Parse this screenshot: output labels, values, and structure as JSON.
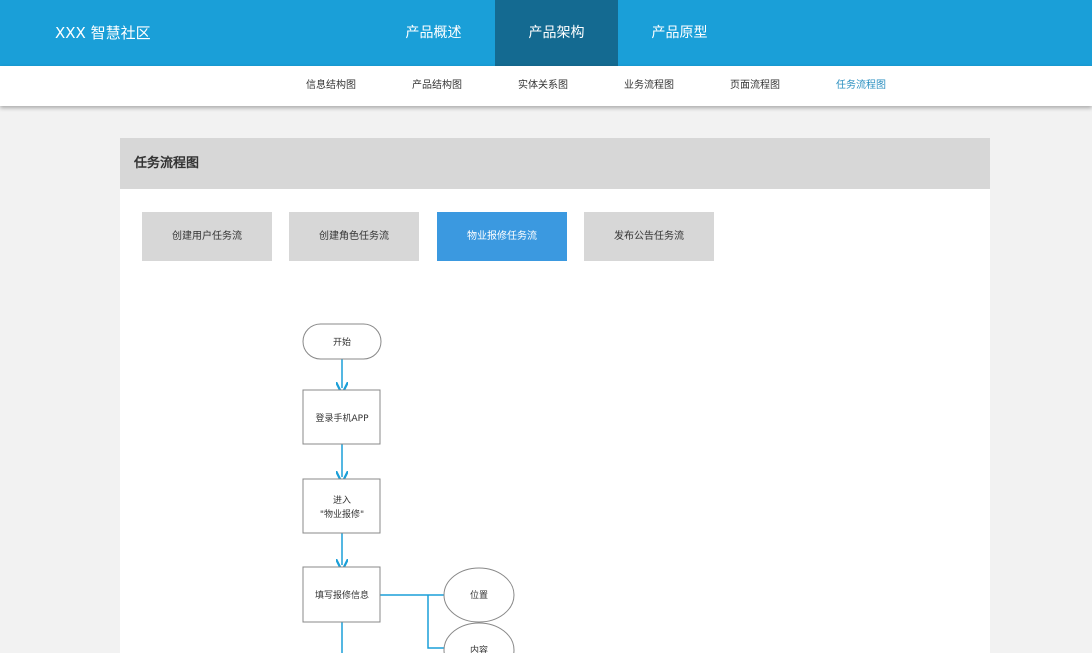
{
  "header": {
    "brand": "XXX 智慧社区",
    "tabs": [
      {
        "label": "产品概述"
      },
      {
        "label": "产品架构"
      },
      {
        "label": "产品原型"
      }
    ]
  },
  "subnav": {
    "items": [
      {
        "label": "信息结构图"
      },
      {
        "label": "产品结构图"
      },
      {
        "label": "实体关系图"
      },
      {
        "label": "业务流程图"
      },
      {
        "label": "页面流程图"
      },
      {
        "label": "任务流程图"
      }
    ]
  },
  "panel": {
    "title": "任务流程图",
    "buttons": [
      {
        "label": "创建用户任务流"
      },
      {
        "label": "创建角色任务流"
      },
      {
        "label": "物业报修任务流"
      },
      {
        "label": "发布公告任务流"
      }
    ]
  },
  "flowchart": {
    "start": "开始",
    "step1": "登录手机APP",
    "step2_line1": "进入",
    "step2_line2": "\"物业报修\"",
    "step3": "填写报修信息",
    "field1": "位置",
    "field2": "内容"
  },
  "colors": {
    "topbar": "#1a9fd8",
    "active_tab": "#146a91",
    "active_button": "#3b99e0",
    "connector": "#1a9fd8"
  }
}
